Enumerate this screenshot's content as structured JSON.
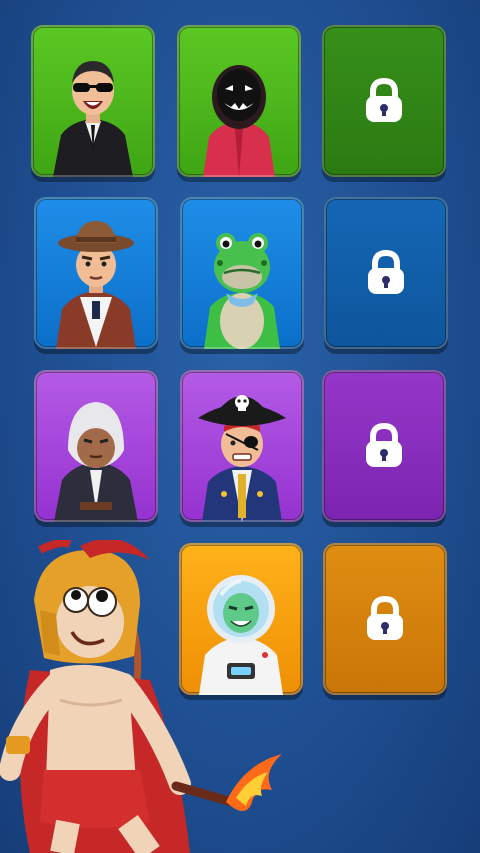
{
  "colors": {
    "background": "#1f4f92",
    "common": "#4cb81c",
    "rare": "#1a86e0",
    "epic": "#a646dd",
    "legendary": "#f8a10f"
  },
  "skins": [
    {
      "name": "agent-skin",
      "tier": "green",
      "state": "unlocked",
      "icon": "suit-agent"
    },
    {
      "name": "guard-skin",
      "tier": "green",
      "state": "unlocked",
      "icon": "masked-guard"
    },
    {
      "name": "locked-green-skin",
      "tier": "green",
      "state": "locked",
      "icon": "lock-icon"
    },
    {
      "name": "cowboy-skin",
      "tier": "blue",
      "state": "unlocked",
      "icon": "cowboy"
    },
    {
      "name": "frog-skin",
      "tier": "blue",
      "state": "unlocked",
      "icon": "frog"
    },
    {
      "name": "locked-blue-skin",
      "tier": "blue",
      "state": "locked",
      "icon": "lock-icon"
    },
    {
      "name": "hooded-skin",
      "tier": "purple",
      "state": "unlocked",
      "icon": "hooded-assassin"
    },
    {
      "name": "pirate-skin",
      "tier": "purple",
      "state": "unlocked",
      "icon": "pirate"
    },
    {
      "name": "locked-purple-skin",
      "tier": "purple",
      "state": "locked",
      "icon": "lock-icon"
    },
    {
      "name": "astronaut-skin",
      "tier": "orange",
      "state": "unlocked",
      "icon": "astronaut"
    },
    {
      "name": "locked-orange-skin",
      "tier": "orange",
      "state": "locked",
      "icon": "lock-icon"
    }
  ],
  "hero": {
    "icon": "spartan-warrior-with-bow-and-torch"
  }
}
